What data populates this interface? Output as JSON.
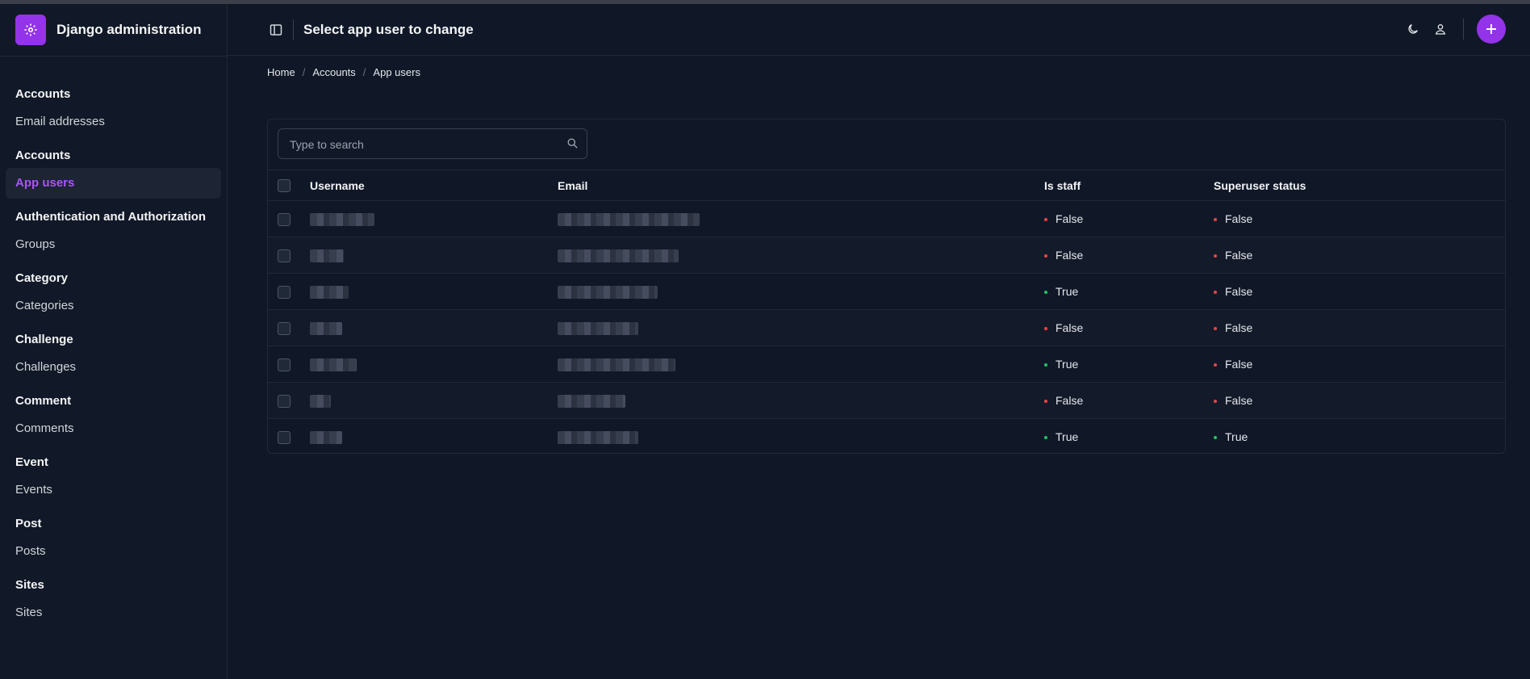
{
  "brand": {
    "title": "Django administration"
  },
  "header": {
    "title": "Select app user to change"
  },
  "breadcrumb": [
    "Home",
    "Accounts",
    "App users"
  ],
  "sidebar": {
    "sections": [
      {
        "label": "Accounts",
        "items": [
          {
            "label": "Email addresses",
            "active": false
          }
        ]
      },
      {
        "label": "Accounts",
        "items": [
          {
            "label": "App users",
            "active": true
          }
        ]
      },
      {
        "label": "Authentication and Authorization",
        "items": [
          {
            "label": "Groups",
            "active": false
          }
        ]
      },
      {
        "label": "Category",
        "items": [
          {
            "label": "Categories",
            "active": false
          }
        ]
      },
      {
        "label": "Challenge",
        "items": [
          {
            "label": "Challenges",
            "active": false
          }
        ]
      },
      {
        "label": "Comment",
        "items": [
          {
            "label": "Comments",
            "active": false
          }
        ]
      },
      {
        "label": "Event",
        "items": [
          {
            "label": "Events",
            "active": false
          }
        ]
      },
      {
        "label": "Post",
        "items": [
          {
            "label": "Posts",
            "active": false
          }
        ]
      },
      {
        "label": "Sites",
        "items": [
          {
            "label": "Sites",
            "active": false
          }
        ]
      }
    ]
  },
  "search": {
    "placeholder": "Type to search"
  },
  "table": {
    "columns": [
      "Username",
      "Email",
      "Is staff",
      "Superuser status"
    ],
    "rows": [
      {
        "is_staff": "False",
        "superuser": "False"
      },
      {
        "is_staff": "False",
        "superuser": "False"
      },
      {
        "is_staff": "True",
        "superuser": "False"
      },
      {
        "is_staff": "False",
        "superuser": "False"
      },
      {
        "is_staff": "True",
        "superuser": "False"
      },
      {
        "is_staff": "False",
        "superuser": "False"
      },
      {
        "is_staff": "True",
        "superuser": "True"
      }
    ]
  },
  "colors": {
    "accent": "#9333ea",
    "true": "#22c55e",
    "false": "#ef4444",
    "background": "#101828"
  }
}
